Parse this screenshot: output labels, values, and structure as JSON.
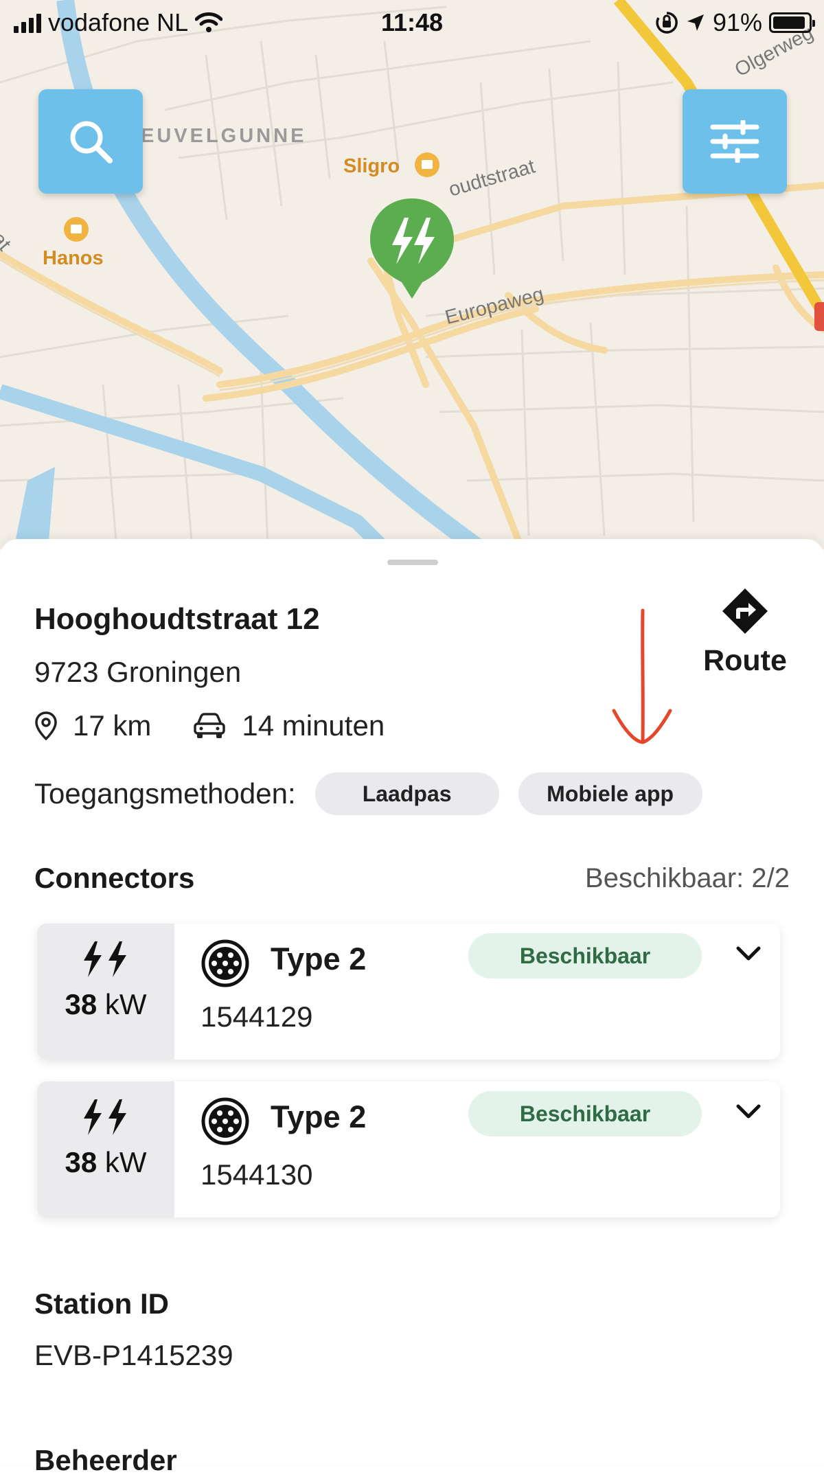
{
  "status_bar": {
    "carrier": "vodafone NL",
    "time": "11:48",
    "battery": "91%",
    "battery_level": 0.91,
    "icons": [
      "signal-icon",
      "wifi-icon",
      "orientation-lock-icon",
      "location-arrow-icon",
      "battery-icon"
    ]
  },
  "map": {
    "labels": {
      "district": "EUVELGUNNE",
      "sligro": "Sligro",
      "hanos": "Hanos",
      "street_hooghoudt": "oudtstraat",
      "street_europaweg": "Europaweg",
      "street_olgerweg": "Olgerweg",
      "edge_left": "aat"
    },
    "colors": {
      "land": "#f3efe6",
      "water": "#a9d3ea",
      "road": "#f5d9a0",
      "highway": "#f3c73a",
      "button": "#6cc0ea",
      "pin": "#5cad4f"
    },
    "search_button_icon": "search-icon",
    "filter_button_icon": "sliders-icon",
    "pin_icon": "charging-station-pin-icon"
  },
  "station": {
    "street": "Hooghoudtstraat 12",
    "city": "9723 Groningen",
    "distance": "17 km",
    "travel_time": "14 minuten",
    "route_label": "Route",
    "access_label": "Toegangsmethoden:",
    "access_methods": [
      "Laadpas",
      "Mobiele app"
    ],
    "connectors_title": "Connectors",
    "availability": "Beschikbaar: 2/2",
    "connectors": [
      {
        "power_value": "38",
        "power_unit": "kW",
        "type": "Type 2",
        "status": "Beschikbaar",
        "id": "1544129"
      },
      {
        "power_value": "38",
        "power_unit": "kW",
        "type": "Type 2",
        "status": "Beschikbaar",
        "id": "1544130"
      }
    ],
    "station_id_label": "Station ID",
    "station_id": "EVB-P1415239",
    "operator_label": "Beheerder"
  },
  "colors": {
    "available_bg": "#e3f3ea",
    "available_text": "#2f6b44",
    "annotation_arrow": "#e5472c"
  }
}
